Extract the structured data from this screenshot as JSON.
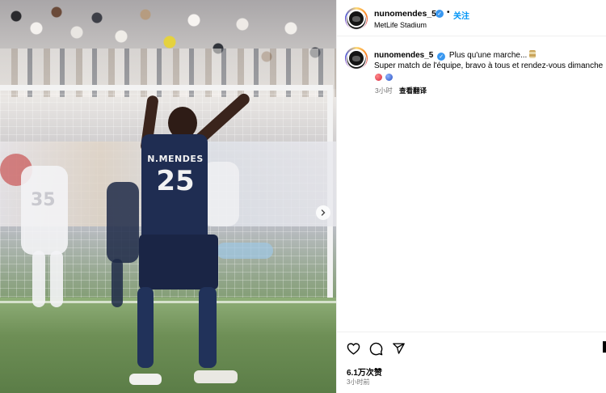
{
  "header": {
    "username": "nunomendes_5",
    "separator": "•",
    "follow_label": "关注",
    "location": "MetLife Stadium"
  },
  "caption": {
    "username": "nunomendes_5",
    "line1": "Plus qu'une marche...",
    "line2": "Super match de l'équipe, bravo à tous et rendez-vous dimanche",
    "emojis": [
      "red-circle",
      "blue-circle"
    ],
    "time": "3小时",
    "translate_label": "查看翻译"
  },
  "photo": {
    "jersey_name": "N.MENDES",
    "jersey_number": "25",
    "background_number": "35"
  },
  "actions": {
    "icons": [
      "heart-icon",
      "comment-icon",
      "share-icon"
    ],
    "likes": "6.1万次赞",
    "time": "3小时前"
  },
  "colors": {
    "accent": "#0095f6",
    "verified": "#3897f0",
    "muted_text": "#737373"
  }
}
